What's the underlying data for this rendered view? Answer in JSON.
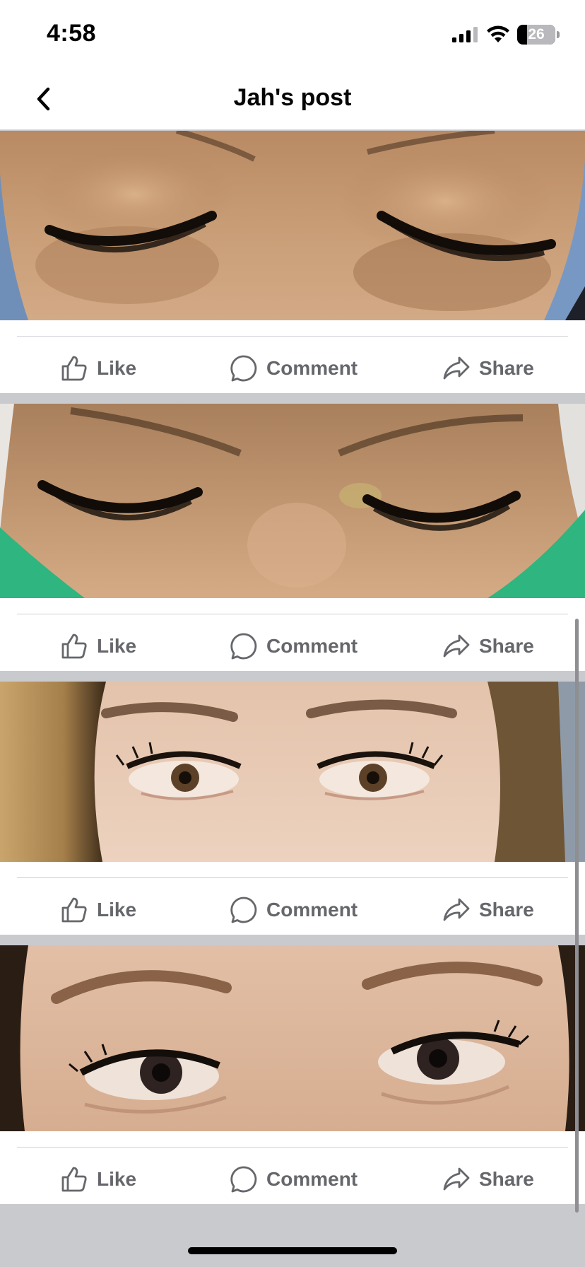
{
  "status_bar": {
    "time": "4:58",
    "battery": "26",
    "battery_level": 0.26,
    "icons": [
      "signal-icon",
      "wifi-icon",
      "battery-icon"
    ]
  },
  "header": {
    "title": "Jah's post",
    "back_icon": "chevron-left-icon"
  },
  "posts": [
    {
      "photo": "closed eyes with volume lash extensions",
      "actions": {
        "like": "Like",
        "comment": "Comment",
        "share": "Share"
      }
    },
    {
      "photo": "closed eyes with lash extensions, green cape",
      "actions": {
        "like": "Like",
        "comment": "Comment",
        "share": "Share"
      }
    },
    {
      "photo": "open brown eyes with lash extensions, blonde hair",
      "actions": {
        "like": "Like",
        "comment": "Comment",
        "share": "Share"
      }
    },
    {
      "photo": "open dark eyes with lash extensions and brows",
      "actions": {
        "like": "Like",
        "comment": "Comment",
        "share": "Share"
      }
    }
  ],
  "colors": {
    "background": "#c9cace",
    "action_text": "#65676b",
    "header_text": "#050505"
  }
}
